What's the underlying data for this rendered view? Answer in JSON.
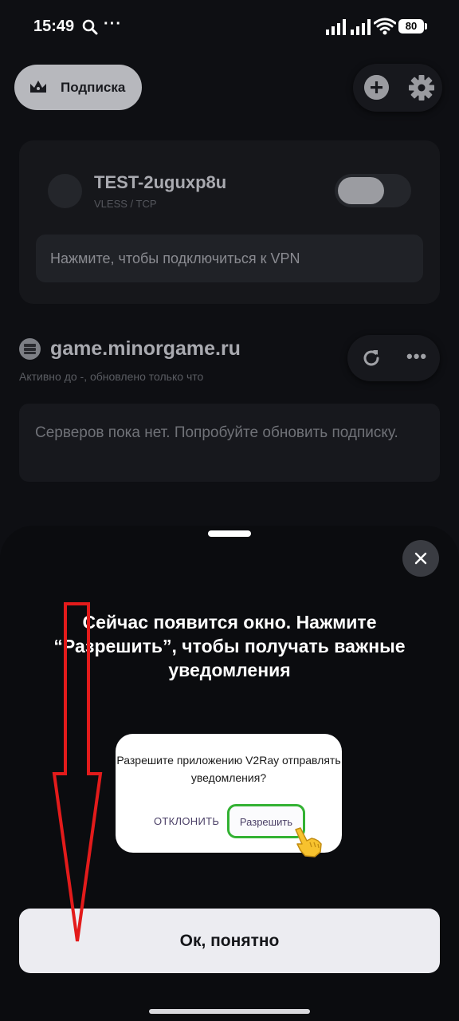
{
  "status_bar": {
    "time": "15:49",
    "battery": "80"
  },
  "header": {
    "subscription_label": "Подписка"
  },
  "connection": {
    "name": "TEST-2uguxp8u",
    "protocol": "VLESS / TCP",
    "hint": "Нажмите, чтобы подключиться к VPN",
    "enabled": false
  },
  "subscription": {
    "name": "game.minorgame.ru",
    "meta": "Активно до -, обновлено только что",
    "empty_text": "Серверов пока нет. Попробуйте обновить подписку."
  },
  "sheet": {
    "title": "Сейчас появится окно. Нажмите “Разрешить”, чтобы получать важные уведомления",
    "dialog_text": "Разрешите приложению V2Ray отправлять уведомления?",
    "deny_label": "ОТКЛОНИТЬ",
    "allow_label": "Разрешить",
    "ok_label": "Ок, понятно"
  },
  "colors": {
    "background": "#0e0f13",
    "allow_highlight": "#33b233",
    "annotation_arrow": "#e31b1b"
  },
  "icons": [
    "search-icon",
    "more-dots-icon",
    "signal-icon",
    "wifi-icon",
    "battery-icon",
    "crown-icon",
    "add-icon",
    "gear-icon",
    "refresh-icon",
    "more-icon",
    "close-icon",
    "pointing-hand-icon"
  ]
}
